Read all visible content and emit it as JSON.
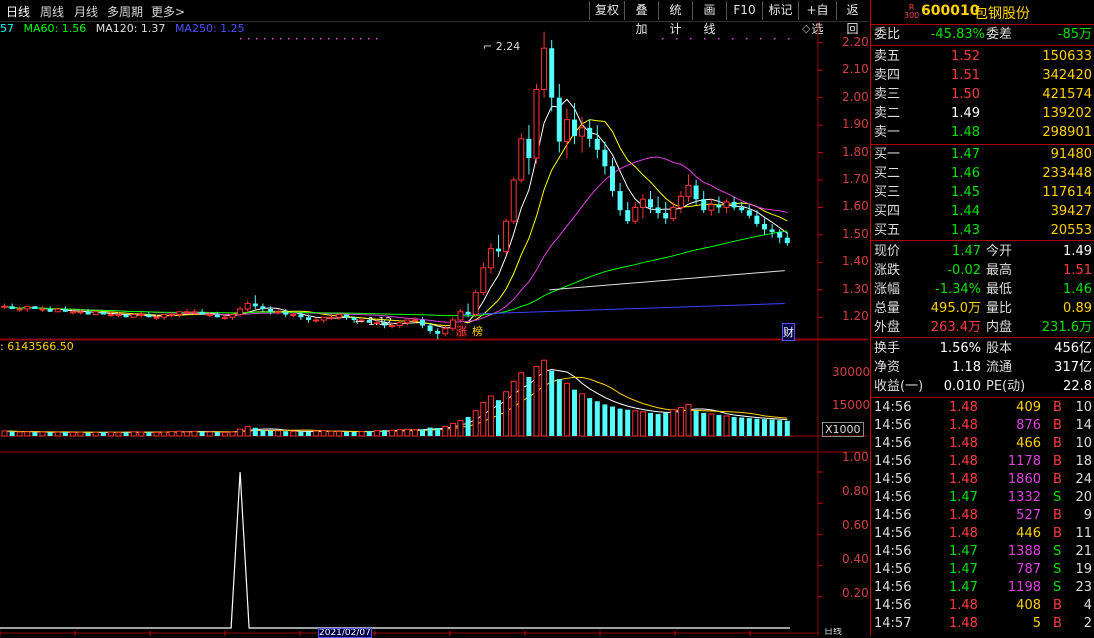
{
  "toolbar": {
    "periods": [
      "日线",
      "周线",
      "月线",
      "多周期",
      "更多>"
    ],
    "buttons": [
      "复权",
      "叠加",
      "统计",
      "画线",
      "F10",
      "标记",
      "+自选",
      "返回"
    ]
  },
  "ma_legend": [
    {
      "text": "57",
      "color": "#00ffff"
    },
    {
      "text": "MA60: 1.56",
      "color": "#00ff00"
    },
    {
      "text": "MA120: 1.37",
      "color": "#e0e0e0"
    },
    {
      "text": "MA250: 1.25",
      "color": "#4040ff"
    }
  ],
  "price_axis": {
    "ticks": [
      "2.20",
      "2.10",
      "2.00",
      "1.90",
      "1.80",
      "1.70",
      "1.60",
      "1.50",
      "1.40",
      "1.30",
      "1.20"
    ],
    "min": 1.15,
    "max": 2.25
  },
  "annotations": {
    "high": "2.24",
    "low": "1.12",
    "limit_up": "涨",
    "hot": "榜",
    "fin": "财"
  },
  "volume": {
    "legend": ": 6143566.50",
    "ticks": [
      "30000",
      "15000"
    ],
    "unit": "X1000"
  },
  "indicator": {
    "ticks": [
      "1.00",
      "0.80",
      "0.60",
      "0.40",
      "0.20"
    ]
  },
  "bottom": {
    "date": "2021/02/07",
    "label": "日线"
  },
  "chart_data": {
    "type": "candlestick",
    "ohlc": [
      [
        1.24,
        1.25,
        1.23,
        1.24
      ],
      [
        1.24,
        1.25,
        1.23,
        1.23
      ],
      [
        1.23,
        1.24,
        1.22,
        1.23
      ],
      [
        1.23,
        1.24,
        1.22,
        1.24
      ],
      [
        1.24,
        1.24,
        1.23,
        1.23
      ],
      [
        1.23,
        1.24,
        1.22,
        1.23
      ],
      [
        1.23,
        1.24,
        1.22,
        1.22
      ],
      [
        1.22,
        1.23,
        1.22,
        1.23
      ],
      [
        1.23,
        1.24,
        1.22,
        1.22
      ],
      [
        1.22,
        1.23,
        1.21,
        1.22
      ],
      [
        1.22,
        1.23,
        1.21,
        1.22
      ],
      [
        1.22,
        1.23,
        1.21,
        1.21
      ],
      [
        1.21,
        1.22,
        1.21,
        1.22
      ],
      [
        1.22,
        1.22,
        1.21,
        1.21
      ],
      [
        1.21,
        1.22,
        1.2,
        1.21
      ],
      [
        1.21,
        1.22,
        1.2,
        1.21
      ],
      [
        1.21,
        1.21,
        1.2,
        1.2
      ],
      [
        1.2,
        1.21,
        1.2,
        1.21
      ],
      [
        1.21,
        1.22,
        1.2,
        1.21
      ],
      [
        1.21,
        1.22,
        1.2,
        1.2
      ],
      [
        1.2,
        1.21,
        1.19,
        1.2
      ],
      [
        1.2,
        1.21,
        1.19,
        1.21
      ],
      [
        1.21,
        1.22,
        1.2,
        1.21
      ],
      [
        1.21,
        1.22,
        1.2,
        1.22
      ],
      [
        1.22,
        1.23,
        1.21,
        1.22
      ],
      [
        1.22,
        1.23,
        1.21,
        1.22
      ],
      [
        1.22,
        1.23,
        1.21,
        1.21
      ],
      [
        1.21,
        1.22,
        1.2,
        1.21
      ],
      [
        1.21,
        1.22,
        1.2,
        1.2
      ],
      [
        1.2,
        1.21,
        1.19,
        1.2
      ],
      [
        1.2,
        1.21,
        1.19,
        1.21
      ],
      [
        1.21,
        1.24,
        1.2,
        1.23
      ],
      [
        1.23,
        1.26,
        1.22,
        1.25
      ],
      [
        1.25,
        1.28,
        1.23,
        1.24
      ],
      [
        1.24,
        1.25,
        1.22,
        1.23
      ],
      [
        1.23,
        1.24,
        1.21,
        1.22
      ],
      [
        1.22,
        1.23,
        1.21,
        1.22
      ],
      [
        1.22,
        1.23,
        1.2,
        1.21
      ],
      [
        1.21,
        1.22,
        1.2,
        1.21
      ],
      [
        1.21,
        1.22,
        1.19,
        1.2
      ],
      [
        1.2,
        1.21,
        1.18,
        1.19
      ],
      [
        1.19,
        1.2,
        1.18,
        1.19
      ],
      [
        1.19,
        1.2,
        1.18,
        1.2
      ],
      [
        1.2,
        1.21,
        1.19,
        1.2
      ],
      [
        1.2,
        1.21,
        1.19,
        1.21
      ],
      [
        1.21,
        1.21,
        1.19,
        1.2
      ],
      [
        1.2,
        1.2,
        1.18,
        1.19
      ],
      [
        1.19,
        1.2,
        1.18,
        1.19
      ],
      [
        1.19,
        1.2,
        1.18,
        1.18
      ],
      [
        1.18,
        1.19,
        1.17,
        1.18
      ],
      [
        1.18,
        1.19,
        1.16,
        1.17
      ],
      [
        1.17,
        1.18,
        1.16,
        1.17
      ],
      [
        1.17,
        1.19,
        1.16,
        1.18
      ],
      [
        1.18,
        1.19,
        1.17,
        1.19
      ],
      [
        1.19,
        1.2,
        1.18,
        1.19
      ],
      [
        1.19,
        1.2,
        1.16,
        1.17
      ],
      [
        1.17,
        1.18,
        1.14,
        1.15
      ],
      [
        1.15,
        1.16,
        1.12,
        1.14
      ],
      [
        1.14,
        1.17,
        1.13,
        1.16
      ],
      [
        1.16,
        1.2,
        1.15,
        1.19
      ],
      [
        1.19,
        1.23,
        1.18,
        1.22
      ],
      [
        1.22,
        1.25,
        1.2,
        1.21
      ],
      [
        1.21,
        1.3,
        1.2,
        1.29
      ],
      [
        1.29,
        1.4,
        1.28,
        1.38
      ],
      [
        1.38,
        1.47,
        1.36,
        1.45
      ],
      [
        1.45,
        1.5,
        1.42,
        1.44
      ],
      [
        1.44,
        1.56,
        1.43,
        1.55
      ],
      [
        1.55,
        1.71,
        1.54,
        1.7
      ],
      [
        1.7,
        1.87,
        1.69,
        1.85
      ],
      [
        1.85,
        1.9,
        1.72,
        1.78
      ],
      [
        1.78,
        2.05,
        1.76,
        2.03
      ],
      [
        2.03,
        2.24,
        2.0,
        2.18
      ],
      [
        2.18,
        2.21,
        1.95,
        2.0
      ],
      [
        2.0,
        2.05,
        1.8,
        1.84
      ],
      [
        1.84,
        1.96,
        1.78,
        1.92
      ],
      [
        1.92,
        1.98,
        1.83,
        1.86
      ],
      [
        1.86,
        1.93,
        1.8,
        1.89
      ],
      [
        1.89,
        1.92,
        1.82,
        1.85
      ],
      [
        1.85,
        1.9,
        1.78,
        1.81
      ],
      [
        1.81,
        1.84,
        1.72,
        1.75
      ],
      [
        1.75,
        1.78,
        1.64,
        1.66
      ],
      [
        1.66,
        1.69,
        1.57,
        1.59
      ],
      [
        1.59,
        1.62,
        1.54,
        1.55
      ],
      [
        1.55,
        1.62,
        1.54,
        1.6
      ],
      [
        1.6,
        1.65,
        1.56,
        1.63
      ],
      [
        1.63,
        1.66,
        1.58,
        1.6
      ],
      [
        1.6,
        1.64,
        1.56,
        1.58
      ],
      [
        1.58,
        1.62,
        1.54,
        1.56
      ],
      [
        1.56,
        1.62,
        1.55,
        1.6
      ],
      [
        1.6,
        1.66,
        1.58,
        1.64
      ],
      [
        1.64,
        1.72,
        1.62,
        1.68
      ],
      [
        1.68,
        1.7,
        1.61,
        1.63
      ],
      [
        1.63,
        1.66,
        1.58,
        1.59
      ],
      [
        1.59,
        1.63,
        1.57,
        1.61
      ],
      [
        1.61,
        1.64,
        1.58,
        1.6
      ],
      [
        1.6,
        1.63,
        1.58,
        1.62
      ],
      [
        1.62,
        1.64,
        1.59,
        1.6
      ],
      [
        1.6,
        1.62,
        1.58,
        1.59
      ],
      [
        1.59,
        1.61,
        1.56,
        1.57
      ],
      [
        1.57,
        1.59,
        1.53,
        1.54
      ],
      [
        1.54,
        1.56,
        1.5,
        1.52
      ],
      [
        1.52,
        1.54,
        1.49,
        1.51
      ],
      [
        1.51,
        1.52,
        1.47,
        1.49
      ],
      [
        1.49,
        1.51,
        1.46,
        1.47
      ]
    ],
    "volume": [
      2400,
      2100,
      1900,
      2000,
      1800,
      1900,
      1700,
      1800,
      1900,
      1700,
      1800,
      1600,
      1700,
      1900,
      1800,
      1700,
      1800,
      2000,
      1900,
      1800,
      1700,
      1900,
      2100,
      2300,
      2000,
      2200,
      2100,
      1900,
      1800,
      1700,
      1900,
      3300,
      4500,
      3900,
      2800,
      2500,
      2400,
      2300,
      2200,
      2000,
      2100,
      2300,
      2500,
      2200,
      2100,
      2000,
      1900,
      2100,
      2300,
      2600,
      2800,
      2700,
      3000,
      3200,
      2900,
      3100,
      4000,
      3800,
      4500,
      6000,
      7400,
      9000,
      12000,
      16000,
      19000,
      17000,
      21000,
      26000,
      30000,
      28000,
      33000,
      36000,
      31000,
      27000,
      25000,
      22000,
      20000,
      18000,
      16500,
      15000,
      14000,
      13000,
      12500,
      12000,
      11500,
      11000,
      10500,
      11000,
      12500,
      13500,
      15000,
      12000,
      11000,
      10500,
      10000,
      9500,
      9000,
      8800,
      8500,
      8200,
      8000,
      7800,
      7500,
      7200
    ],
    "indicator_peak": {
      "index": 31,
      "value": 1.0
    },
    "ma_levels": {
      "MA60": 1.56,
      "MA120": 1.37,
      "MA250": 1.25
    }
  },
  "panel": {
    "code": "600010",
    "name": "包钢股份",
    "tag_top": "R",
    "tag_bottom": "300",
    "weibi": {
      "label": "委比",
      "value": "-45.83%",
      "label2": "委差",
      "value2": "-85万"
    },
    "sell": [
      {
        "label": "卖五",
        "price": "1.52",
        "qty": "150633",
        "color": "red"
      },
      {
        "label": "卖四",
        "price": "1.51",
        "qty": "342420",
        "color": "red"
      },
      {
        "label": "卖三",
        "price": "1.50",
        "qty": "421574",
        "color": "red"
      },
      {
        "label": "卖二",
        "price": "1.49",
        "qty": "139202",
        "color": "white"
      },
      {
        "label": "卖一",
        "price": "1.48",
        "qty": "298901",
        "color": "green"
      }
    ],
    "buy": [
      {
        "label": "买一",
        "price": "1.47",
        "qty": "91480"
      },
      {
        "label": "买二",
        "price": "1.46",
        "qty": "233448"
      },
      {
        "label": "买三",
        "price": "1.45",
        "qty": "117614"
      },
      {
        "label": "买四",
        "price": "1.44",
        "qty": "39427"
      },
      {
        "label": "买五",
        "price": "1.43",
        "qty": "20553"
      }
    ],
    "stats": [
      {
        "l1": "现价",
        "v1": "1.47",
        "c1": "green",
        "l2": "今开",
        "v2": "1.49",
        "c2": "white"
      },
      {
        "l1": "涨跌",
        "v1": "-0.02",
        "c1": "green",
        "l2": "最高",
        "v2": "1.51",
        "c2": "red"
      },
      {
        "l1": "涨幅",
        "v1": "-1.34%",
        "c1": "green",
        "l2": "最低",
        "v2": "1.46",
        "c2": "green"
      },
      {
        "l1": "总量",
        "v1": "495.0万",
        "c1": "yellow",
        "l2": "量比",
        "v2": "0.89",
        "c2": "yellow"
      },
      {
        "l1": "外盘",
        "v1": "263.4万",
        "c1": "red",
        "l2": "内盘",
        "v2": "231.6万",
        "c2": "green"
      }
    ],
    "stats2": [
      {
        "l1": "换手",
        "v1": "1.56%",
        "l2": "股本",
        "v2": "456亿"
      },
      {
        "l1": "净资",
        "v1": "1.18",
        "l2": "流通",
        "v2": "317亿"
      },
      {
        "l1": "收益(一)",
        "v1": "0.010",
        "l2": "PE(动)",
        "v2": "22.8"
      }
    ],
    "ticks": [
      {
        "t": "14:56",
        "p": "1.48",
        "v": "409",
        "bs": "B",
        "n": "10",
        "vc": "yellow"
      },
      {
        "t": "14:56",
        "p": "1.48",
        "v": "876",
        "bs": "B",
        "n": "14",
        "vc": "magenta"
      },
      {
        "t": "14:56",
        "p": "1.48",
        "v": "466",
        "bs": "B",
        "n": "10",
        "vc": "yellow"
      },
      {
        "t": "14:56",
        "p": "1.48",
        "v": "1178",
        "bs": "B",
        "n": "18",
        "vc": "magenta"
      },
      {
        "t": "14:56",
        "p": "1.48",
        "v": "1860",
        "bs": "B",
        "n": "24",
        "vc": "magenta"
      },
      {
        "t": "14:56",
        "p": "1.47",
        "v": "1332",
        "bs": "S",
        "n": "20",
        "vc": "magenta"
      },
      {
        "t": "14:56",
        "p": "1.48",
        "v": "527",
        "bs": "B",
        "n": "9",
        "vc": "magenta"
      },
      {
        "t": "14:56",
        "p": "1.48",
        "v": "446",
        "bs": "B",
        "n": "11",
        "vc": "yellow"
      },
      {
        "t": "14:56",
        "p": "1.47",
        "v": "1388",
        "bs": "S",
        "n": "21",
        "vc": "magenta"
      },
      {
        "t": "14:56",
        "p": "1.47",
        "v": "787",
        "bs": "S",
        "n": "19",
        "vc": "magenta"
      },
      {
        "t": "14:56",
        "p": "1.47",
        "v": "1198",
        "bs": "S",
        "n": "23",
        "vc": "magenta"
      },
      {
        "t": "14:56",
        "p": "1.48",
        "v": "408",
        "bs": "B",
        "n": "4",
        "vc": "yellow"
      },
      {
        "t": "14:57",
        "p": "1.48",
        "v": "5",
        "bs": "B",
        "n": "2",
        "vc": "yellow"
      }
    ]
  }
}
